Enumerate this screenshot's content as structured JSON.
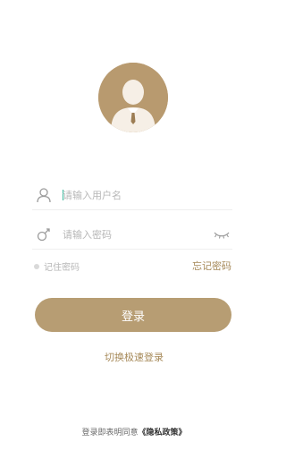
{
  "avatar": {
    "icon": "user-avatar-icon"
  },
  "username": {
    "placeholder": "请输入用户名",
    "value": "",
    "icon": "user-icon"
  },
  "password": {
    "placeholder": "请输入密码",
    "value": "",
    "icon": "key-icon",
    "toggle_icon": "eye-closed-icon"
  },
  "remember": {
    "label": "记住密码",
    "checked": false
  },
  "forgot": {
    "label": "忘记密码"
  },
  "login_button": {
    "label": "登录"
  },
  "switch_login": {
    "label": "切换极速登录"
  },
  "privacy": {
    "prefix": "登录即表明同意",
    "link": "《隐私政策》"
  },
  "colors": {
    "accent": "#b79d73",
    "text_accent": "#a68958",
    "caret": "#38b79a"
  }
}
